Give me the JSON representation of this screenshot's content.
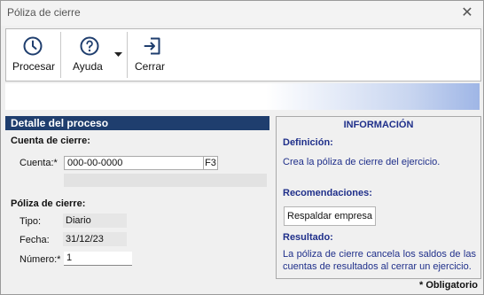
{
  "window": {
    "title": "Póliza de cierre"
  },
  "toolbar": {
    "process_label": "Procesar",
    "help_label": "Ayuda",
    "close_label": "Cerrar",
    "icons": [
      "clock-icon",
      "help-icon",
      "dropdown-arrow-icon",
      "exit-icon"
    ]
  },
  "left": {
    "header": "Detalle del proceso",
    "closing_account": {
      "section": "Cuenta de cierre:",
      "label": "Cuenta:*",
      "value": "000-00-0000",
      "f3": "F3"
    },
    "policy": {
      "section": "Póliza de cierre:",
      "type_label": "Tipo:",
      "type_value": "Diario",
      "date_label": "Fecha:",
      "date_value": "31/12/23",
      "number_label": "Número:*",
      "number_value": "1"
    }
  },
  "info": {
    "title": "INFORMACIÓN",
    "definition_heading": "Definición:",
    "definition_text": "Crea la póliza de cierre del ejercicio.",
    "recommendations_heading": "Recomendaciones:",
    "backup_button": "Respaldar empresa",
    "result_heading": "Resultado:",
    "result_text": "La póliza de cierre cancela los saldos de las cuentas de resultados al cerrar un ejercicio."
  },
  "footer": {
    "required_note": "* Obligatorio"
  },
  "colors": {
    "header_bg": "#1f3e6e",
    "info_text": "#1f2f8a",
    "icon_blue": "#1f3e6e"
  }
}
